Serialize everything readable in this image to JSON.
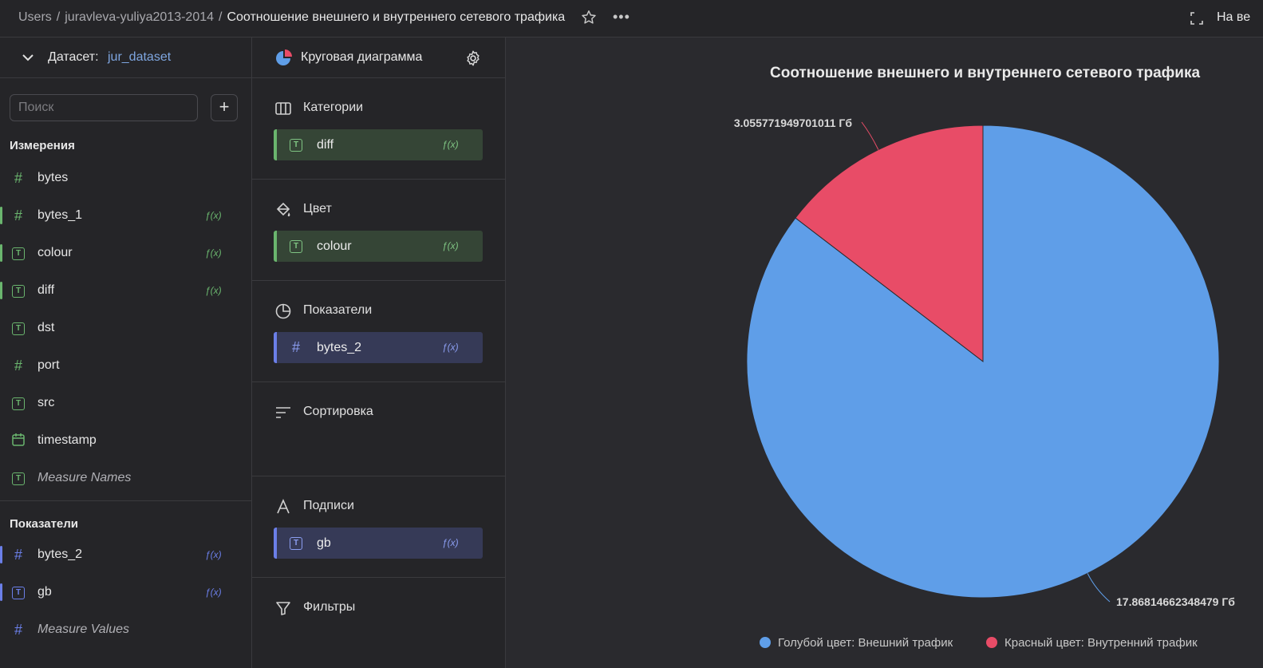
{
  "breadcrumb": {
    "items": [
      "Users",
      "juravleva-yuliya2013-2014"
    ],
    "separator": "/",
    "current": "Соотношение внешнего и внутреннего сетевого трафика"
  },
  "top_right": {
    "fullscreen_label": "На ве"
  },
  "dataset": {
    "label": "Датасет:",
    "name": "jur_dataset"
  },
  "search": {
    "placeholder": "Поиск"
  },
  "add_button": "+",
  "dimensions": {
    "title": "Измерения",
    "items": [
      {
        "name": "bytes",
        "type": "#",
        "fx": ""
      },
      {
        "name": "bytes_1",
        "type": "#",
        "fx": "ƒ(x)"
      },
      {
        "name": "colour",
        "type": "T",
        "fx": "ƒ(x)"
      },
      {
        "name": "diff",
        "type": "T",
        "fx": "ƒ(x)"
      },
      {
        "name": "dst",
        "type": "T",
        "fx": ""
      },
      {
        "name": "port",
        "type": "#",
        "fx": ""
      },
      {
        "name": "src",
        "type": "T",
        "fx": ""
      },
      {
        "name": "timestamp",
        "type": "date",
        "fx": ""
      },
      {
        "name": "Measure Names",
        "type": "T",
        "fx": ""
      }
    ]
  },
  "measures": {
    "title": "Показатели",
    "items": [
      {
        "name": "bytes_2",
        "type": "#",
        "fx": "ƒ(x)"
      },
      {
        "name": "gb",
        "type": "T",
        "fx": "ƒ(x)"
      },
      {
        "name": "Measure Values",
        "type": "#",
        "fx": ""
      }
    ]
  },
  "visualization": {
    "chart_type": "Круговая диаграмма",
    "sections": {
      "categories": {
        "title": "Категории",
        "chip": "diff",
        "fx": "ƒ(x)"
      },
      "color": {
        "title": "Цвет",
        "chip": "colour",
        "fx": "ƒ(x)"
      },
      "measures": {
        "title": "Показатели",
        "chip": "bytes_2",
        "fx": "ƒ(x)"
      },
      "sort": {
        "title": "Сортировка"
      },
      "labels": {
        "title": "Подписи",
        "chip": "gb",
        "fx": "ƒ(x)"
      },
      "filters": {
        "title": "Фильтры"
      }
    }
  },
  "colors": {
    "blue": "#5f9ee8",
    "red": "#e84c67",
    "green": "#6ab56e",
    "accent_blue": "#6b7fe8"
  },
  "chart_data": {
    "type": "pie",
    "title": "Соотношение внешнего и внутреннего сетевого трафика",
    "slices": [
      {
        "name": "Голубой цвет: Внешний трафик",
        "value": 17.86814662348479,
        "label": "17.86814662348479 Гб",
        "color": "#5f9ee8"
      },
      {
        "name": "Красный цвет: Внутренний трафик",
        "value": 3.055771949701011,
        "label": "3.055771949701011 Гб",
        "color": "#e84c67"
      }
    ],
    "legend_position": "bottom"
  }
}
